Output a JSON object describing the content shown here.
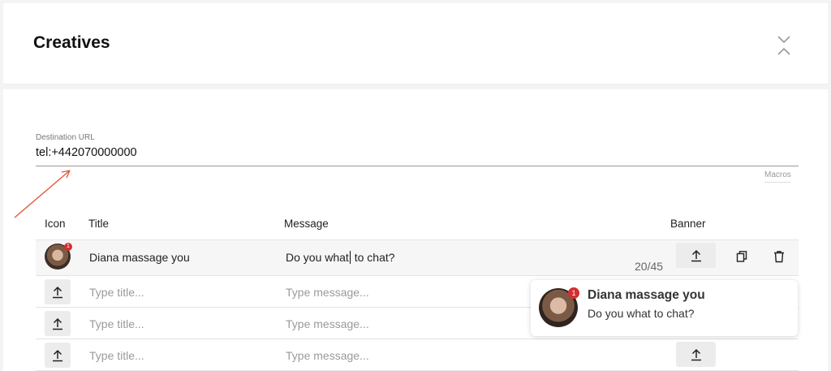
{
  "header": {
    "title": "Creatives"
  },
  "destination": {
    "label": "Destination URL",
    "value": "tel:+442070000000",
    "macros_label": "Macros"
  },
  "table": {
    "columns": [
      "Icon",
      "Title",
      "Message",
      "Banner"
    ],
    "first_row": {
      "title": "Diana massage you",
      "message_before_caret": "Do you what",
      "message_after_caret": " to chat?",
      "badge": "1",
      "counter": "20/45"
    },
    "title_placeholder": "Type title...",
    "message_placeholder": "Type message..."
  },
  "preview": {
    "title": "Diana massage you",
    "message": "Do you what to chat?",
    "badge": "1"
  },
  "colors": {
    "badge": "#d32f2f",
    "arrow": "#e05a3c"
  },
  "icons": [
    "close-icon",
    "upload-icon",
    "copy-icon",
    "trash-icon"
  ]
}
